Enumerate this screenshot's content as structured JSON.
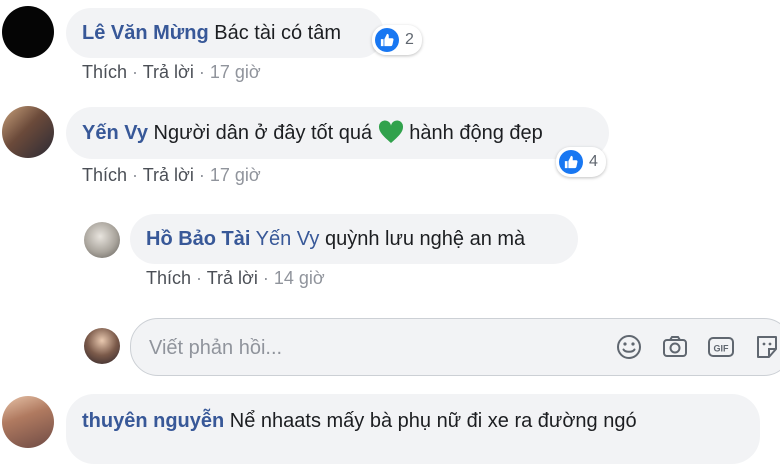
{
  "comments": [
    {
      "author": "Lê Văn Mừng",
      "text": "Bác tài có tâm",
      "reactions": "2",
      "actions": {
        "like": "Thích",
        "reply": "Trả lời",
        "time": "17 giờ"
      }
    },
    {
      "author": "Yến Vy",
      "text_before": "Người dân ở đây tốt quá",
      "emoji": "green-heart",
      "text_after": "hành động đẹp",
      "reactions": "4",
      "actions": {
        "like": "Thích",
        "reply": "Trả lời",
        "time": "17 giờ"
      }
    }
  ],
  "reply": {
    "author": "Hồ Bảo Tài",
    "mention": "Yến Vy",
    "text": "quỳnh lưu nghệ an mà",
    "actions": {
      "like": "Thích",
      "reply": "Trả lời",
      "time": "14 giờ"
    }
  },
  "reply_box": {
    "placeholder": "Viết phản hồi...",
    "tools": [
      "emoji-icon",
      "camera-icon",
      "gif-icon",
      "sticker-icon"
    ]
  },
  "last_comment": {
    "author": "thuyên nguyễn",
    "text": "Nể nhaats mấy bà phụ nữ đi xe ra đường ngó"
  },
  "colors": {
    "author": "#385898",
    "bubble": "#f2f3f5",
    "like": "#1877f2",
    "heart": "#31a24c"
  }
}
